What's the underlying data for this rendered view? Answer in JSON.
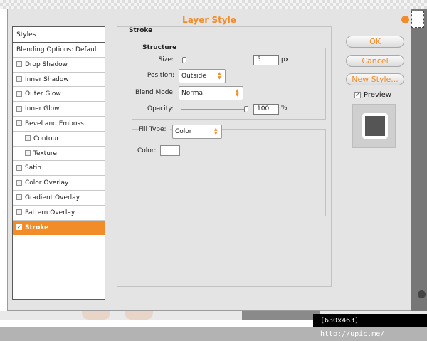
{
  "dialog": {
    "title": "Layer Style"
  },
  "styles_list": {
    "header": "Styles",
    "items": [
      {
        "label": "Blending Options: Default",
        "checkbox": false,
        "indent": false,
        "active": false
      },
      {
        "label": "Drop Shadow",
        "checkbox": true,
        "checked": false,
        "indent": false,
        "active": false
      },
      {
        "label": "Inner Shadow",
        "checkbox": true,
        "checked": false,
        "indent": false,
        "active": false
      },
      {
        "label": "Outer Glow",
        "checkbox": true,
        "checked": false,
        "indent": false,
        "active": false
      },
      {
        "label": "Inner Glow",
        "checkbox": true,
        "checked": false,
        "indent": false,
        "active": false
      },
      {
        "label": "Bevel and Emboss",
        "checkbox": true,
        "checked": false,
        "indent": false,
        "active": false
      },
      {
        "label": "Contour",
        "checkbox": true,
        "checked": false,
        "indent": true,
        "active": false
      },
      {
        "label": "Texture",
        "checkbox": true,
        "checked": false,
        "indent": true,
        "active": false
      },
      {
        "label": "Satin",
        "checkbox": true,
        "checked": false,
        "indent": false,
        "active": false
      },
      {
        "label": "Color Overlay",
        "checkbox": true,
        "checked": false,
        "indent": false,
        "active": false
      },
      {
        "label": "Gradient Overlay",
        "checkbox": true,
        "checked": false,
        "indent": false,
        "active": false
      },
      {
        "label": "Pattern Overlay",
        "checkbox": true,
        "checked": false,
        "indent": false,
        "active": false
      },
      {
        "label": "Stroke",
        "checkbox": true,
        "checked": true,
        "indent": false,
        "active": true
      }
    ]
  },
  "stroke_panel": {
    "section_title": "Stroke",
    "structure_title": "Structure",
    "size_label": "Size:",
    "size_value": "5",
    "size_unit": "px",
    "position_label": "Position:",
    "position_value": "Outside",
    "blend_mode_label": "Blend Mode:",
    "blend_mode_value": "Normal",
    "opacity_label": "Opacity:",
    "opacity_value": "100",
    "opacity_unit": "%",
    "fill_type_label": "Fill Type:",
    "fill_type_value": "Color",
    "color_label": "Color:",
    "color_value": "#ffffff"
  },
  "buttons": {
    "ok": "OK",
    "cancel": "Cancel",
    "new_style": "New Style..."
  },
  "preview": {
    "label": "Preview",
    "checked": true
  },
  "footer": {
    "text": "[630x463] http://upic.me/"
  },
  "colors": {
    "accent": "#f28c28",
    "dialog_bg": "#e4e4e4",
    "preview_fill": "#555555"
  }
}
